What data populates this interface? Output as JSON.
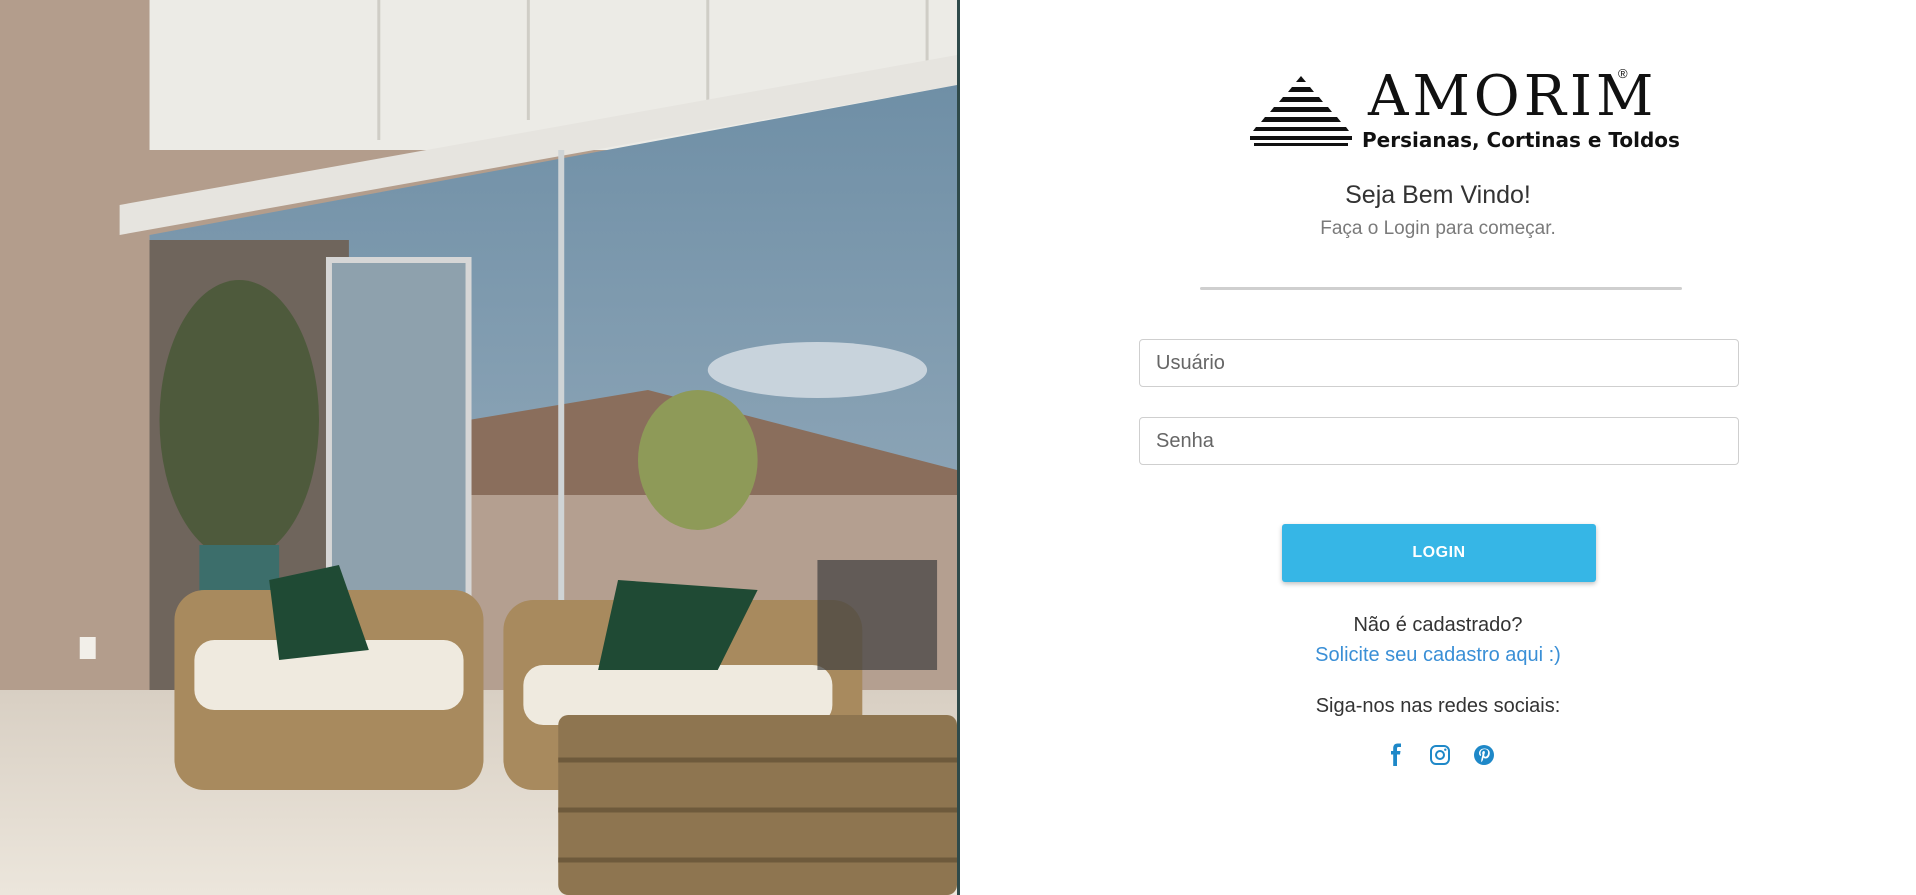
{
  "brand": {
    "name": "AMORIM",
    "registered": "®",
    "tagline": "Persianas, Cortinas e Toldos"
  },
  "welcome": {
    "title": "Seja Bem Vindo!",
    "subtitle": "Faça o Login para começar."
  },
  "form": {
    "username_placeholder": "Usuário",
    "username_value": "",
    "password_placeholder": "Senha",
    "password_value": "",
    "login_label": "LOGIN"
  },
  "register": {
    "question": "Não é cadastrado?",
    "link_label": "Solicite seu cadastro aqui :)"
  },
  "social": {
    "heading": "Siga-nos nas redes sociais:",
    "icons": [
      "facebook-icon",
      "instagram-icon",
      "pinterest-icon"
    ]
  },
  "colors": {
    "accent": "#36b6e6",
    "link": "#3a8fd6",
    "social": "#1e88c8",
    "photo_frame": "#2f4a4a"
  }
}
